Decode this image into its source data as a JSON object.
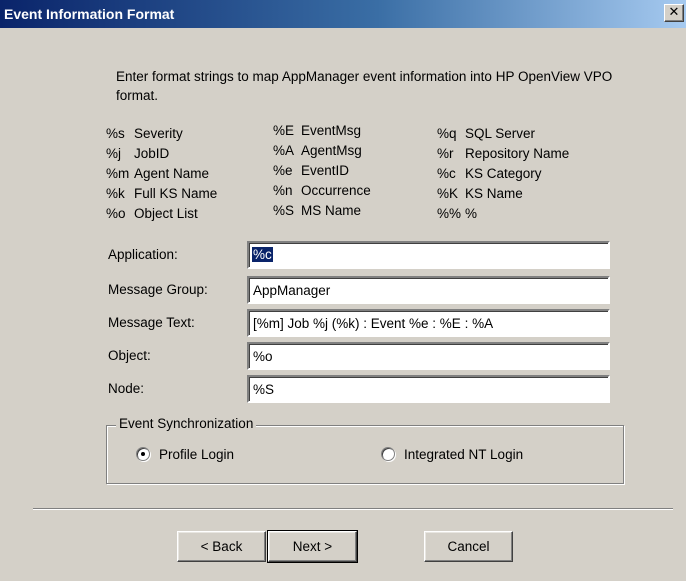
{
  "window": {
    "title": "Event Information Format",
    "close_glyph": "✕"
  },
  "intro": "Enter format strings to map AppManager event information into HP OpenView VPO format.",
  "format_codes": {
    "col1": [
      {
        "code": "%s",
        "desc": "Severity"
      },
      {
        "code": "%j",
        "desc": "JobID"
      },
      {
        "code": "%m",
        "desc": "Agent Name"
      },
      {
        "code": "%k",
        "desc": "Full KS Name"
      },
      {
        "code": "%o",
        "desc": "Object List"
      }
    ],
    "col2": [
      {
        "code": "%E",
        "desc": "EventMsg"
      },
      {
        "code": "%A",
        "desc": "AgentMsg"
      },
      {
        "code": "%e",
        "desc": "EventID"
      },
      {
        "code": "%n",
        "desc": "Occurrence"
      },
      {
        "code": "%S",
        "desc": "MS Name"
      }
    ],
    "col3": [
      {
        "code": "%q",
        "desc": "SQL Server"
      },
      {
        "code": "%r",
        "desc": "Repository Name"
      },
      {
        "code": "%c",
        "desc": "KS Category"
      },
      {
        "code": "%K",
        "desc": "KS Name"
      },
      {
        "code": "%%",
        "desc": "%"
      }
    ]
  },
  "fields": {
    "application": {
      "label": "Application:",
      "value": "%c"
    },
    "message_group": {
      "label": "Message Group:",
      "value": "AppManager"
    },
    "message_text": {
      "label": "Message Text:",
      "value": "[%m] Job %j (%k) : Event %e : %E : %A"
    },
    "object": {
      "label": "Object:",
      "value": "%o"
    },
    "node": {
      "label": "Node:",
      "value": "%S"
    }
  },
  "event_sync": {
    "label": "Event Synchronization",
    "options": [
      {
        "label": "Profile Login",
        "checked": true
      },
      {
        "label": "Integrated NT Login",
        "checked": false
      }
    ]
  },
  "buttons": {
    "back": "< Back",
    "next": "Next >",
    "cancel": "Cancel"
  }
}
